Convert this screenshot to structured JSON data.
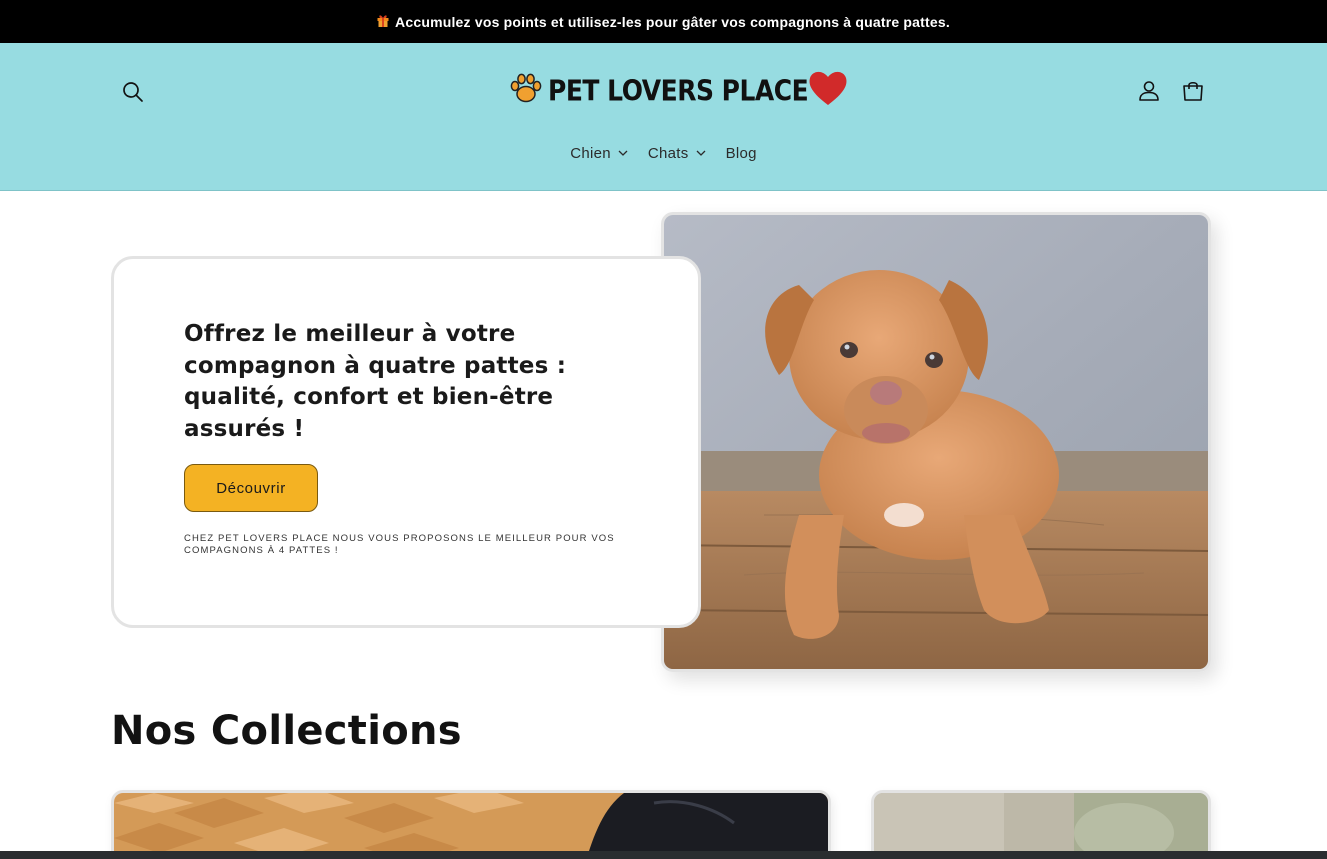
{
  "announcement": {
    "icon": "gift-icon",
    "text": "Accumulez vos points et utilisez-les pour gâter vos compagnons à quatre pattes."
  },
  "header": {
    "background": "#97dce1",
    "logo_text": "PET LOVERS PLACE",
    "icons": [
      "search-icon",
      "paw-icon",
      "heart-icon",
      "account-icon",
      "cart-icon"
    ],
    "nav": [
      {
        "label": "Chien",
        "has_dropdown": true
      },
      {
        "label": "Chats",
        "has_dropdown": true
      },
      {
        "label": "Blog",
        "has_dropdown": false
      }
    ]
  },
  "hero": {
    "title": "Offrez le meilleur à votre compagnon à quatre pattes : qualité, confort et bien-être assurés !",
    "button_label": "Découvrir",
    "button_color": "#f4b223",
    "subtext": "CHEZ PET LOVERS PLACE NOUS VOUS PROPOSONS LE MEILLEUR POUR VOS COMPAGNONS À 4 PATTES !",
    "image": "puppy-photo"
  },
  "collections": {
    "title": "Nos Collections",
    "cards": [
      "dog-collection-photo",
      "cat-collection-photo"
    ]
  }
}
